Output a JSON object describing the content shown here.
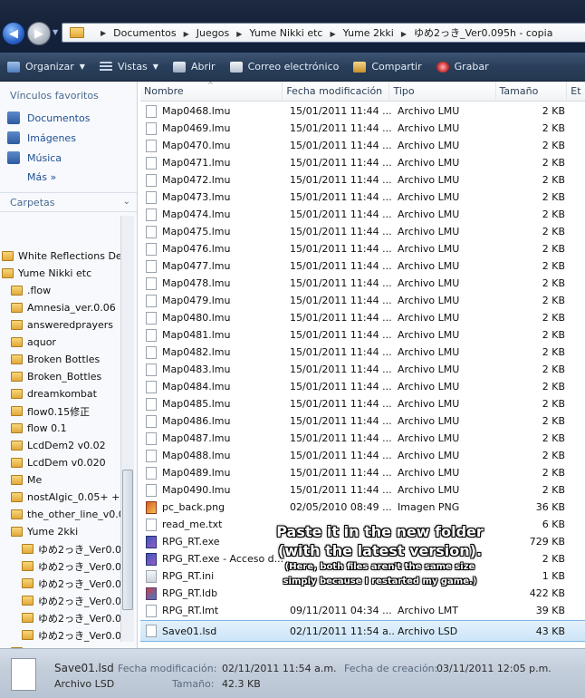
{
  "address": {
    "crumbs": [
      "Documentos",
      "Juegos",
      "Yume Nikki etc",
      "Yume 2kki",
      "ゆめ2っき_Ver0.095h - copia"
    ]
  },
  "toolbar": {
    "organize": "Organizar",
    "views": "Vistas",
    "open": "Abrir",
    "email": "Correo electrónico",
    "share": "Compartir",
    "burn": "Grabar"
  },
  "nav": {
    "favorites_header": "Vínculos favoritos",
    "favorites": [
      "Documentos",
      "Imágenes",
      "Música"
    ],
    "more": "Más  »",
    "folders_header": "Carpetas",
    "tree": [
      {
        "label": "White Reflections De",
        "indent": 0
      },
      {
        "label": "Yume Nikki etc",
        "indent": 0
      },
      {
        "label": ".flow",
        "indent": 1
      },
      {
        "label": "Amnesia_ver.0.06",
        "indent": 1
      },
      {
        "label": "answeredprayers",
        "indent": 1
      },
      {
        "label": "aquor",
        "indent": 1
      },
      {
        "label": "Broken Bottles",
        "indent": 1
      },
      {
        "label": "Broken_Bottles",
        "indent": 1
      },
      {
        "label": "dreamkombat",
        "indent": 1
      },
      {
        "label": "flow0.15修正",
        "indent": 1
      },
      {
        "label": "flow 0.1",
        "indent": 1
      },
      {
        "label": "LcdDem2 v0.02",
        "indent": 1
      },
      {
        "label": "LcdDem v0.020",
        "indent": 1
      },
      {
        "label": "Me",
        "indent": 1
      },
      {
        "label": "nostAlgic_0.05+ +",
        "indent": 1
      },
      {
        "label": "the_other_line_v0.0",
        "indent": 1
      },
      {
        "label": "Yume 2kki",
        "indent": 1
      },
      {
        "label": "ゆめ2っき_Ver0.0",
        "indent": 2
      },
      {
        "label": "ゆめ2っき_Ver0.0",
        "indent": 2
      },
      {
        "label": "ゆめ2っき_Ver0.0",
        "indent": 2
      },
      {
        "label": "ゆめ2っき_Ver0.0",
        "indent": 2
      },
      {
        "label": "ゆめ2っき_Ver0.0",
        "indent": 2
      },
      {
        "label": "ゆめ2っき_Ver0.0",
        "indent": 2
      },
      {
        "label": "Yume Nikki",
        "indent": 1
      }
    ]
  },
  "columns": [
    "Nombre",
    "Fecha modificación",
    "Tipo",
    "Tamaño",
    "Et"
  ],
  "files": [
    {
      "name": "Map0468.lmu",
      "date": "15/01/2011 11:44 ...",
      "type": "Archivo LMU",
      "size": "2 KB",
      "icon": "doc"
    },
    {
      "name": "Map0469.lmu",
      "date": "15/01/2011 11:44 ...",
      "type": "Archivo LMU",
      "size": "2 KB",
      "icon": "doc"
    },
    {
      "name": "Map0470.lmu",
      "date": "15/01/2011 11:44 ...",
      "type": "Archivo LMU",
      "size": "2 KB",
      "icon": "doc"
    },
    {
      "name": "Map0471.lmu",
      "date": "15/01/2011 11:44 ...",
      "type": "Archivo LMU",
      "size": "2 KB",
      "icon": "doc"
    },
    {
      "name": "Map0472.lmu",
      "date": "15/01/2011 11:44 ...",
      "type": "Archivo LMU",
      "size": "2 KB",
      "icon": "doc"
    },
    {
      "name": "Map0473.lmu",
      "date": "15/01/2011 11:44 ...",
      "type": "Archivo LMU",
      "size": "2 KB",
      "icon": "doc"
    },
    {
      "name": "Map0474.lmu",
      "date": "15/01/2011 11:44 ...",
      "type": "Archivo LMU",
      "size": "2 KB",
      "icon": "doc"
    },
    {
      "name": "Map0475.lmu",
      "date": "15/01/2011 11:44 ...",
      "type": "Archivo LMU",
      "size": "2 KB",
      "icon": "doc"
    },
    {
      "name": "Map0476.lmu",
      "date": "15/01/2011 11:44 ...",
      "type": "Archivo LMU",
      "size": "2 KB",
      "icon": "doc"
    },
    {
      "name": "Map0477.lmu",
      "date": "15/01/2011 11:44 ...",
      "type": "Archivo LMU",
      "size": "2 KB",
      "icon": "doc"
    },
    {
      "name": "Map0478.lmu",
      "date": "15/01/2011 11:44 ...",
      "type": "Archivo LMU",
      "size": "2 KB",
      "icon": "doc"
    },
    {
      "name": "Map0479.lmu",
      "date": "15/01/2011 11:44 ...",
      "type": "Archivo LMU",
      "size": "2 KB",
      "icon": "doc"
    },
    {
      "name": "Map0480.lmu",
      "date": "15/01/2011 11:44 ...",
      "type": "Archivo LMU",
      "size": "2 KB",
      "icon": "doc"
    },
    {
      "name": "Map0481.lmu",
      "date": "15/01/2011 11:44 ...",
      "type": "Archivo LMU",
      "size": "2 KB",
      "icon": "doc"
    },
    {
      "name": "Map0482.lmu",
      "date": "15/01/2011 11:44 ...",
      "type": "Archivo LMU",
      "size": "2 KB",
      "icon": "doc"
    },
    {
      "name": "Map0483.lmu",
      "date": "15/01/2011 11:44 ...",
      "type": "Archivo LMU",
      "size": "2 KB",
      "icon": "doc"
    },
    {
      "name": "Map0484.lmu",
      "date": "15/01/2011 11:44 ...",
      "type": "Archivo LMU",
      "size": "2 KB",
      "icon": "doc"
    },
    {
      "name": "Map0485.lmu",
      "date": "15/01/2011 11:44 ...",
      "type": "Archivo LMU",
      "size": "2 KB",
      "icon": "doc"
    },
    {
      "name": "Map0486.lmu",
      "date": "15/01/2011 11:44 ...",
      "type": "Archivo LMU",
      "size": "2 KB",
      "icon": "doc"
    },
    {
      "name": "Map0487.lmu",
      "date": "15/01/2011 11:44 ...",
      "type": "Archivo LMU",
      "size": "2 KB",
      "icon": "doc"
    },
    {
      "name": "Map0488.lmu",
      "date": "15/01/2011 11:44 ...",
      "type": "Archivo LMU",
      "size": "2 KB",
      "icon": "doc"
    },
    {
      "name": "Map0489.lmu",
      "date": "15/01/2011 11:44 ...",
      "type": "Archivo LMU",
      "size": "2 KB",
      "icon": "doc"
    },
    {
      "name": "Map0490.lmu",
      "date": "15/01/2011 11:44 ...",
      "type": "Archivo LMU",
      "size": "2 KB",
      "icon": "doc"
    },
    {
      "name": "pc_back.png",
      "date": "02/05/2010 08:49 ...",
      "type": "Imagen PNG",
      "size": "36 KB",
      "icon": "img"
    },
    {
      "name": "read_me.txt",
      "date": "",
      "type": "",
      "size": "6 KB",
      "icon": "doc"
    },
    {
      "name": "RPG_RT.exe",
      "date": "",
      "type": "",
      "size": "729 KB",
      "icon": "exe"
    },
    {
      "name": "RPG_RT.exe - Acceso d...",
      "date": "",
      "type": "",
      "size": "2 KB",
      "icon": "exe"
    },
    {
      "name": "RPG_RT.ini",
      "date": "",
      "type": "",
      "size": "1 KB",
      "icon": "ini"
    },
    {
      "name": "RPG_RT.ldb",
      "date": "",
      "type": "",
      "size": "422 KB",
      "icon": "ldb"
    },
    {
      "name": "RPG_RT.lmt",
      "date": "09/11/2011 04:34 ...",
      "type": "Archivo LMT",
      "size": "39 KB",
      "icon": "doc"
    },
    {
      "name": "Save01.lsd",
      "date": "02/11/2011 11:54 a...",
      "type": "Archivo LSD",
      "size": "43 KB",
      "icon": "doc"
    }
  ],
  "annotation": {
    "line1": "Paste it in the new folder",
    "line2": "(with the latest version).",
    "line3": "(Here, both files aren't the same size",
    "line4": "simply because I restarted my game.)"
  },
  "details": {
    "name": "Save01.lsd",
    "type": "Archivo LSD",
    "modified_label": "Fecha modificación:",
    "modified": "02/11/2011 11:54 a.m.",
    "size_label": "Tamaño:",
    "size": "42.3 KB",
    "created_label": "Fecha de creación:",
    "created": "03/11/2011 12:05 p.m."
  }
}
